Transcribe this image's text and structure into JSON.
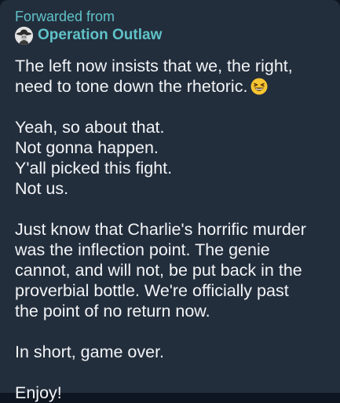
{
  "forward": {
    "label": "Forwarded from",
    "source_name": "Operation Outlaw",
    "avatar_icon": "cowboy-avatar-icon"
  },
  "message": {
    "paragraph1": {
      "line1": "The left now insists that we, the right,",
      "line2": "need to tone down the rhetoric.",
      "emoji": "laughing-squint-emoji-icon"
    },
    "paragraph2": {
      "line1": "Yeah, so about that.",
      "line2": "Not gonna happen.",
      "line3": "Y'all picked this fight.",
      "line4": "Not us."
    },
    "paragraph3": {
      "line1": "Just know that Charlie's horrific murder",
      "line2": "was the inflection point. The genie",
      "line3": "cannot, and will not, be put back in the",
      "line4": "proverbial bottle.  We're officially past",
      "line5": "the point of no return now."
    },
    "paragraph4": {
      "line1": "In short, game over."
    },
    "paragraph5": {
      "line1": "Enjoy!"
    }
  },
  "colors": {
    "background": "#0e1621",
    "bubble": "#232e3c",
    "accent": "#5fc2c8",
    "text": "#f2f4f7"
  }
}
